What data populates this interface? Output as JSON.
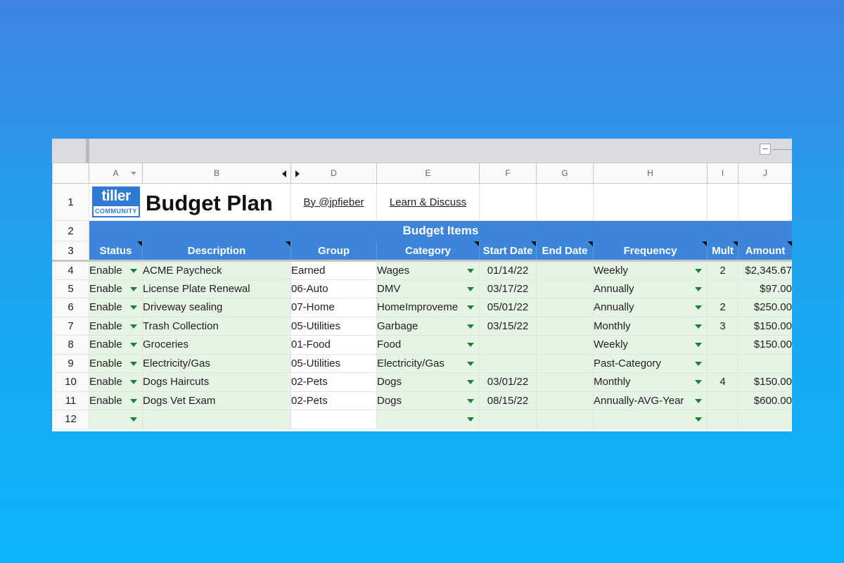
{
  "app": {
    "logo_top": "tiller",
    "logo_bottom": "COMMUNITY",
    "title": "Budget Plan",
    "link_author": "By @jpfieber",
    "link_learn": "Learn & Discuss",
    "collapse_symbol": "−"
  },
  "columns": [
    "A",
    "B",
    "D",
    "E",
    "F",
    "G",
    "H",
    "I",
    "J"
  ],
  "row_numbers": [
    "1",
    "2",
    "3",
    "4",
    "5",
    "6",
    "7",
    "8",
    "9",
    "10",
    "11",
    "12"
  ],
  "band_title": "Budget Items",
  "headers": [
    "Status",
    "Description",
    "Group",
    "Category",
    "Start Date",
    "End Date",
    "Frequency",
    "Mult",
    "Amount"
  ],
  "rows": [
    {
      "status": "Enable",
      "description": "ACME Paycheck",
      "group": "Earned",
      "category": "Wages",
      "start": "01/14/22",
      "end": "",
      "frequency": "Weekly",
      "mult": "2",
      "amount": "$2,345.67"
    },
    {
      "status": "Enable",
      "description": "License Plate Renewal",
      "group": "06-Auto",
      "category": "DMV",
      "start": "03/17/22",
      "end": "",
      "frequency": "Annually",
      "mult": "",
      "amount": "$97.00"
    },
    {
      "status": "Enable",
      "description": "Driveway sealing",
      "group": "07-Home",
      "category": "HomeImproveme",
      "start": "05/01/22",
      "end": "",
      "frequency": "Annually",
      "mult": "2",
      "amount": "$250.00"
    },
    {
      "status": "Enable",
      "description": "Trash Collection",
      "group": "05-Utilities",
      "category": "Garbage",
      "start": "03/15/22",
      "end": "",
      "frequency": "Monthly",
      "mult": "3",
      "amount": "$150.00"
    },
    {
      "status": "Enable",
      "description": "Groceries",
      "group": "01-Food",
      "category": "Food",
      "start": "",
      "end": "",
      "frequency": "Weekly",
      "mult": "",
      "amount": "$150.00"
    },
    {
      "status": "Enable",
      "description": "Electricity/Gas",
      "group": "05-Utilities",
      "category": "Electricity/Gas",
      "start": "",
      "end": "",
      "frequency": "Past-Category",
      "mult": "",
      "amount": ""
    },
    {
      "status": "Enable",
      "description": "Dogs Haircuts",
      "group": "02-Pets",
      "category": "Dogs",
      "start": "03/01/22",
      "end": "",
      "frequency": "Monthly",
      "mult": "4",
      "amount": "$150.00"
    },
    {
      "status": "Enable",
      "description": "Dogs Vet Exam",
      "group": "02-Pets",
      "category": "Dogs",
      "start": "08/15/22",
      "end": "",
      "frequency": "Annually-AVG-Year",
      "mult": "",
      "amount": "$600.00"
    },
    {
      "status": "",
      "description": "",
      "group": "",
      "category": "",
      "start": "",
      "end": "",
      "frequency": "",
      "mult": "",
      "amount": ""
    }
  ],
  "colors": {
    "header_blue": "#3d85da",
    "row_green": "#e6f4e4",
    "dropdown_green": "#188038"
  }
}
